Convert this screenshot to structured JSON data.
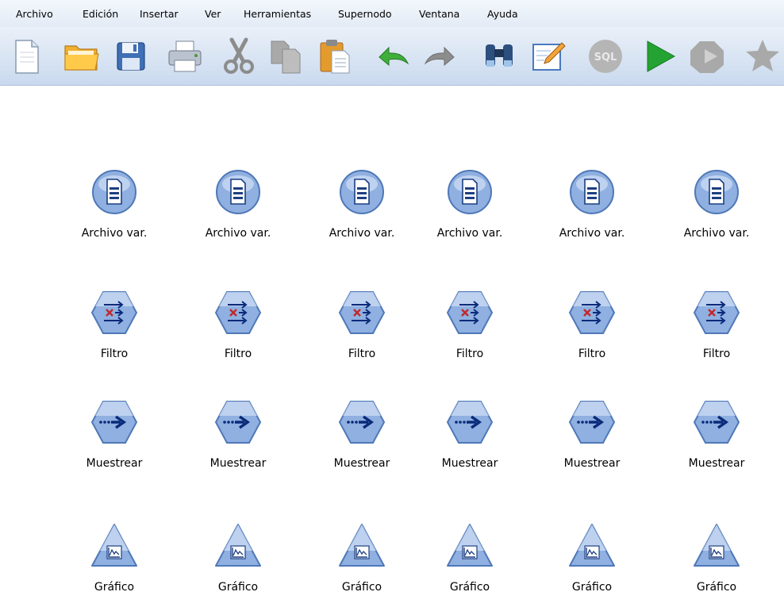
{
  "menu": {
    "items": [
      {
        "label": "Archivo"
      },
      {
        "label": "Edición"
      },
      {
        "label": "Insertar"
      },
      {
        "label": "Ver"
      },
      {
        "label": "Herramientas"
      },
      {
        "label": "Supernodo"
      },
      {
        "label": "Ventana"
      },
      {
        "label": "Ayuda"
      }
    ]
  },
  "toolbar": {
    "buttons": [
      {
        "icon": "new-document-icon"
      },
      {
        "icon": "open-folder-icon"
      },
      {
        "icon": "save-disk-icon"
      },
      {
        "icon": "printer-icon"
      },
      {
        "icon": "cut-scissors-icon"
      },
      {
        "icon": "copy-icon"
      },
      {
        "icon": "paste-clipboard-icon"
      },
      {
        "icon": "undo-arrow-icon"
      },
      {
        "icon": "redo-arrow-icon"
      },
      {
        "icon": "find-binoculars-icon"
      },
      {
        "icon": "edit-annotation-icon"
      },
      {
        "icon": "sql-icon",
        "text": "SQL"
      },
      {
        "icon": "run-stream-icon"
      },
      {
        "icon": "run-selection-icon"
      },
      {
        "icon": "favorite-star-icon"
      }
    ]
  },
  "canvas": {
    "rows": [
      {
        "type": "file",
        "label": "Archivo var.",
        "count": 6
      },
      {
        "type": "filter",
        "label": "Filtro",
        "count": 6
      },
      {
        "type": "sample",
        "label": "Muestrear",
        "count": 6
      },
      {
        "type": "graph",
        "label": "Gráfico",
        "count": 6
      }
    ]
  },
  "colors": {
    "node_fill": "#8fb0e0",
    "node_stroke": "#4f78b8",
    "arrow": "#0a2a7a",
    "filter_cross": "#c0282c"
  }
}
